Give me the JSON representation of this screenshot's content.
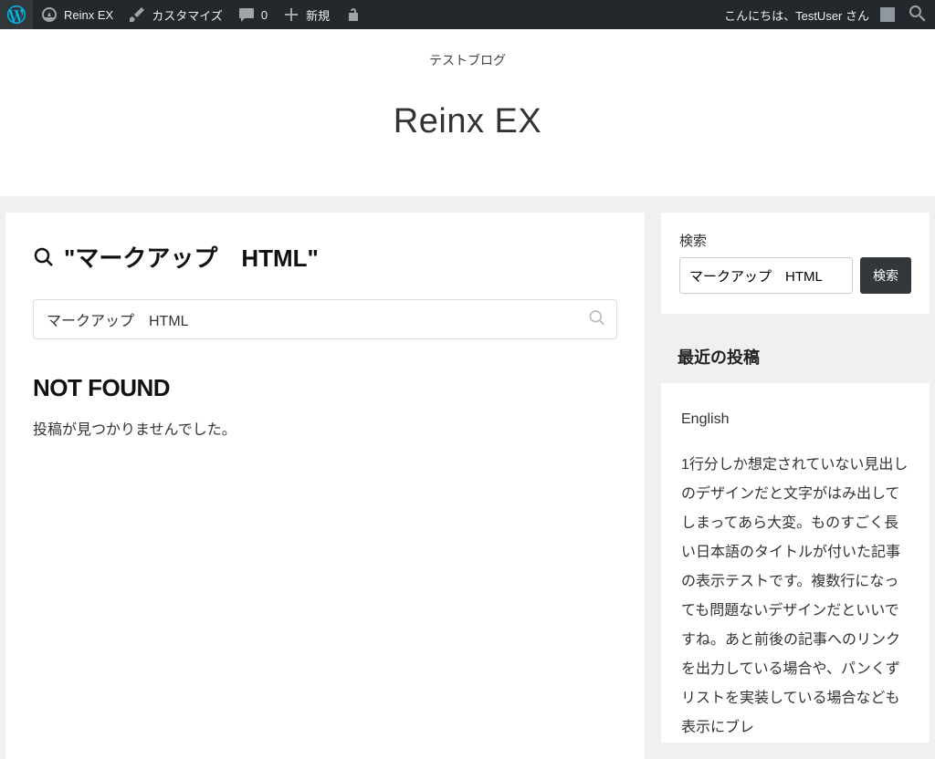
{
  "adminbar": {
    "site_name": "Reinx EX",
    "customize": "カスタマイズ",
    "comments_count": "0",
    "new": "新規",
    "greeting": "こんにちは、TestUser さん"
  },
  "header": {
    "description": "テストブログ",
    "title": "Reinx EX"
  },
  "main": {
    "search_heading_prefix": "\"",
    "search_heading_term": "マークアップ　HTML",
    "search_heading_suffix": "\"",
    "search_input_value": "マークアップ　HTML",
    "notfound_title": "NOT FOUND",
    "notfound_message": "投稿が見つかりませんでした。"
  },
  "sidebar": {
    "search_label": "検索",
    "search_value": "マークアップ　HTML",
    "search_button": "検索",
    "recent_title": "最近の投稿",
    "posts": [
      "English",
      "1行分しか想定されていない見出しのデザインだと文字がはみ出してしまってあら大変。ものすごく長い日本語のタイトルが付いた記事の表示テストです。複数行になっても問題ないデザインだといいですね。あと前後の記事へのリンクを出力している場合や、パンくずリストを実装している場合なども表示にブレ"
    ]
  }
}
